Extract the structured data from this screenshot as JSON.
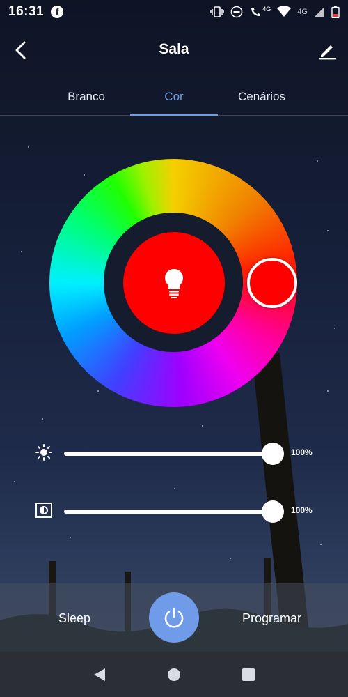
{
  "status_bar": {
    "time": "16:31",
    "network_label_1": "4G",
    "network_label_2": "4G",
    "icons": [
      "facebook-icon",
      "vibrate-icon",
      "do-not-disturb-icon",
      "wifi-calling-icon",
      "wifi-icon",
      "signal-icon",
      "battery-icon"
    ]
  },
  "header": {
    "title": "Sala",
    "back_icon": "chevron-left-icon",
    "edit_icon": "pencil-icon"
  },
  "tabs": [
    {
      "label": "Branco",
      "active": false
    },
    {
      "label": "Cor",
      "active": true
    },
    {
      "label": "Cenários",
      "active": false
    }
  ],
  "color": {
    "selected_hex": "#ff0000",
    "center_icon": "lightbulb-icon"
  },
  "sliders": {
    "brightness": {
      "icon": "sun-icon",
      "value_label": "100%",
      "value": 1.0
    },
    "saturation": {
      "icon": "contrast-icon",
      "value_label": "100%",
      "value": 1.0
    }
  },
  "bottom": {
    "left_label": "Sleep",
    "right_label": "Programar",
    "power_icon": "power-icon",
    "accent": "#6f9be8"
  },
  "nav": {
    "icons": [
      "back-triangle-icon",
      "home-circle-icon",
      "recents-square-icon"
    ]
  }
}
